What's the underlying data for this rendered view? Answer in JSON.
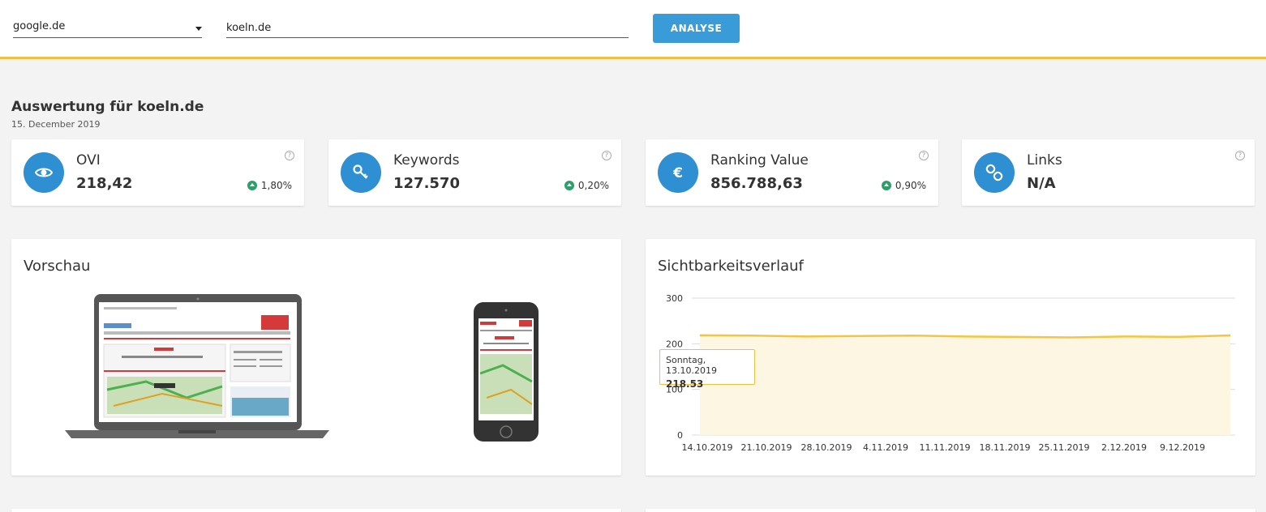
{
  "header": {
    "search_engine": "google.de",
    "domain_value": "koeln.de",
    "analyse_label": "ANALYSE"
  },
  "page": {
    "title": "Auswertung für koeln.de",
    "date": "15. December 2019"
  },
  "kpis": [
    {
      "label": "OVI",
      "value": "218,42",
      "change": "1,80%",
      "icon": "eye-icon"
    },
    {
      "label": "Keywords",
      "value": "127.570",
      "change": "0,20%",
      "icon": "key-icon"
    },
    {
      "label": "Ranking Value",
      "value": "856.788,63",
      "change": "0,90%",
      "icon": "euro-icon"
    },
    {
      "label": "Links",
      "value": "N/A",
      "change": "",
      "icon": "link-icon"
    }
  ],
  "preview": {
    "title": "Vorschau"
  },
  "visibility": {
    "title": "Sichtbarkeitsverlauf",
    "tooltip_date": "Sonntag, 13.10.2019",
    "tooltip_value": "218.53"
  },
  "colors": {
    "accent": "#3a9bd9",
    "icon_circle": "#2e8fd2",
    "header_border": "#f0c040",
    "trend_up": "#2e9e6a",
    "line": "#f5c542",
    "area": "#fdf6e3"
  },
  "chart_data": {
    "type": "area",
    "title": "Sichtbarkeitsverlauf",
    "x": [
      "13.10.2019",
      "14.10.2019",
      "21.10.2019",
      "28.10.2019",
      "4.11.2019",
      "11.11.2019",
      "18.11.2019",
      "25.11.2019",
      "2.12.2019",
      "9.12.2019",
      "15.12.2019"
    ],
    "values": [
      218.53,
      218,
      216,
      217,
      218,
      216,
      215,
      214,
      216,
      215,
      218.42
    ],
    "tick_labels": [
      "14.10.2019",
      "21.10.2019",
      "28.10.2019",
      "4.11.2019",
      "11.11.2019",
      "18.11.2019",
      "25.11.2019",
      "2.12.2019",
      "9.12.2019"
    ],
    "yticks": [
      0,
      100,
      200,
      300
    ],
    "ylim": [
      0,
      300
    ],
    "grid": true
  }
}
